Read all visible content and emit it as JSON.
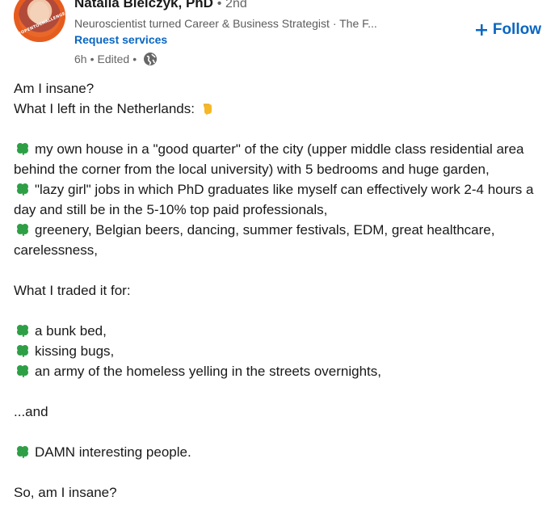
{
  "header": {
    "avatar_text": "#OPENTOCHALLENGE",
    "name": "Natalia Bielczyk, PhD",
    "degree_separator": "•",
    "degree": "2nd",
    "headline": "Neuroscientist turned Career & Business Strategist · The F...",
    "request_services": "Request services",
    "time": "6h",
    "separator": "•",
    "edited": "Edited",
    "follow_label": "Follow",
    "icons": {
      "visibility": "globe-icon",
      "follow": "plus-icon"
    }
  },
  "post": {
    "intro_line_1": "Am I insane?",
    "intro_line_2": "What I left in the Netherlands:",
    "left_items": [
      "my own house in a \"good quarter\" of the city (upper middle class residential area behind the corner from the local university) with 5 bedrooms and huge garden,",
      "\"lazy girl\" jobs in which PhD graduates like myself can effectively work 2-4 hours a day and still be in the 5-10% top paid professionals,",
      "greenery, Belgian beers, dancing, summer festivals, EDM, great healthcare, carelessness,"
    ],
    "traded_heading": "What I traded it for:",
    "traded_items": [
      "a bunk bed,",
      "kissing bugs,",
      "an army of the homeless yelling in the streets overnights,"
    ],
    "and_line": "...and",
    "final_item": "DAMN interesting people.",
    "closing": "So, am I insane?",
    "icons": {
      "bullet": "four-leaf-clover-icon",
      "pointing": "pointing-down-hand-icon"
    }
  },
  "colors": {
    "link": "#0a66c2",
    "text": "#191919",
    "muted": "#666666",
    "clover": "#2e9f45",
    "pointing_hand": "#f6b826"
  }
}
